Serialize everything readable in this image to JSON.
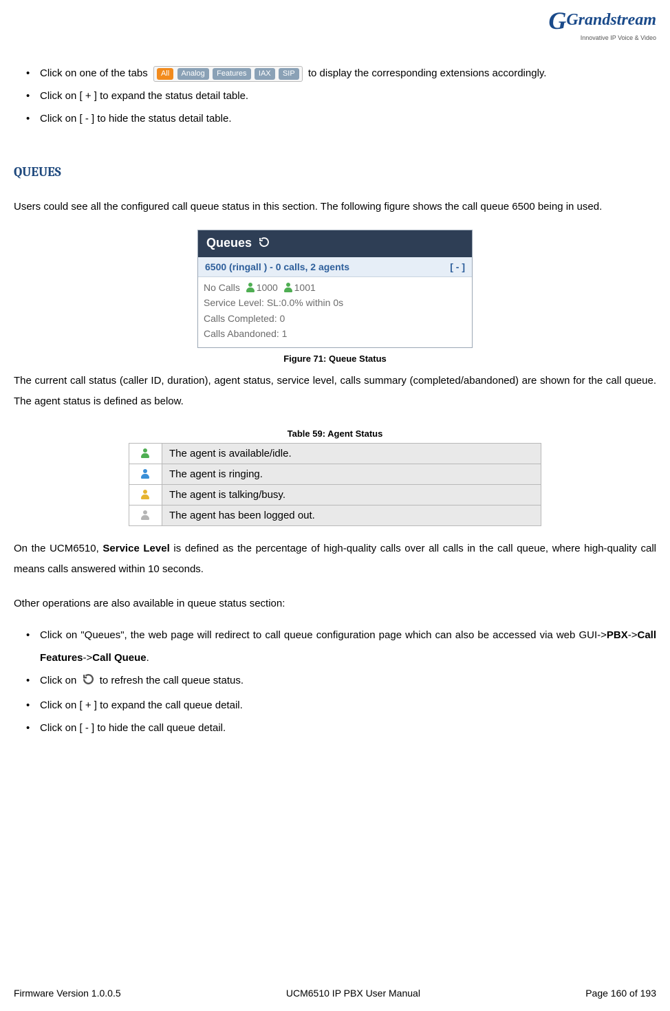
{
  "logo": {
    "brand": "Grandstream",
    "tagline": "Innovative IP Voice & Video"
  },
  "bullets_top": {
    "b1_a": "Click on one of the tabs ",
    "b1_b": " to display the corresponding extensions accordingly.",
    "b2": "Click on [ + ] to expand the status detail table.",
    "b3": "Click on [ - ] to hide the status detail table."
  },
  "tabs": {
    "all": "All",
    "analog": "Analog",
    "features": "Features",
    "iax": "IAX",
    "sip": "SIP"
  },
  "section_title": "QUEUES",
  "p1": "Users could see all the configured call queue status in this section. The following figure shows the call queue 6500 being in used.",
  "queues_panel": {
    "header": "Queues",
    "subheader": "6500 (ringall ) - 0 calls, 2 agents",
    "toggle": "[ - ]",
    "nocalls": "No Calls",
    "agent1": "1000",
    "agent2": "1001",
    "line_sl": "Service Level: SL:0.0% within 0s",
    "line_comp": "Calls Completed: 0",
    "line_aban": "Calls Abandoned: 1"
  },
  "fig_caption": "Figure 71: Queue Status",
  "p2": "The current call status (caller ID, duration), agent status, service level, calls summary (completed/abandoned) are shown for the call queue. The agent status is defined as below.",
  "tbl_caption": "Table 59: Agent Status",
  "agent_status": {
    "r1": "The agent is available/idle.",
    "r2": "The agent is ringing.",
    "r3": "The agent is talking/busy.",
    "r4": "The agent has been logged out."
  },
  "p3_a": "On the UCM6510, ",
  "p3_b": "Service Level",
  "p3_c": " is defined as the percentage of high-quality calls over all calls in the call queue, where high-quality call means calls answered within 10 seconds.",
  "p4": "Other operations are also available in queue status section:",
  "bullets_bottom": {
    "b1_a": "Click on \"Queues\", the web page will redirect to call queue configuration page which can also be accessed via web GUI->",
    "b1_pbx": "PBX",
    "b1_arrow1": "->",
    "b1_cf": "Call Features",
    "b1_arrow2": "->",
    "b1_cq": "Call Queue",
    "b1_dot": ".",
    "b2_a": "Click on ",
    "b2_b": " to refresh the call queue status.",
    "b3": "Click on [ + ] to expand the call queue detail.",
    "b4": "Click on [ - ] to hide the call queue detail."
  },
  "footer": {
    "left": "Firmware Version 1.0.0.5",
    "center": "UCM6510 IP PBX User Manual",
    "right": "Page 160 of 193"
  }
}
